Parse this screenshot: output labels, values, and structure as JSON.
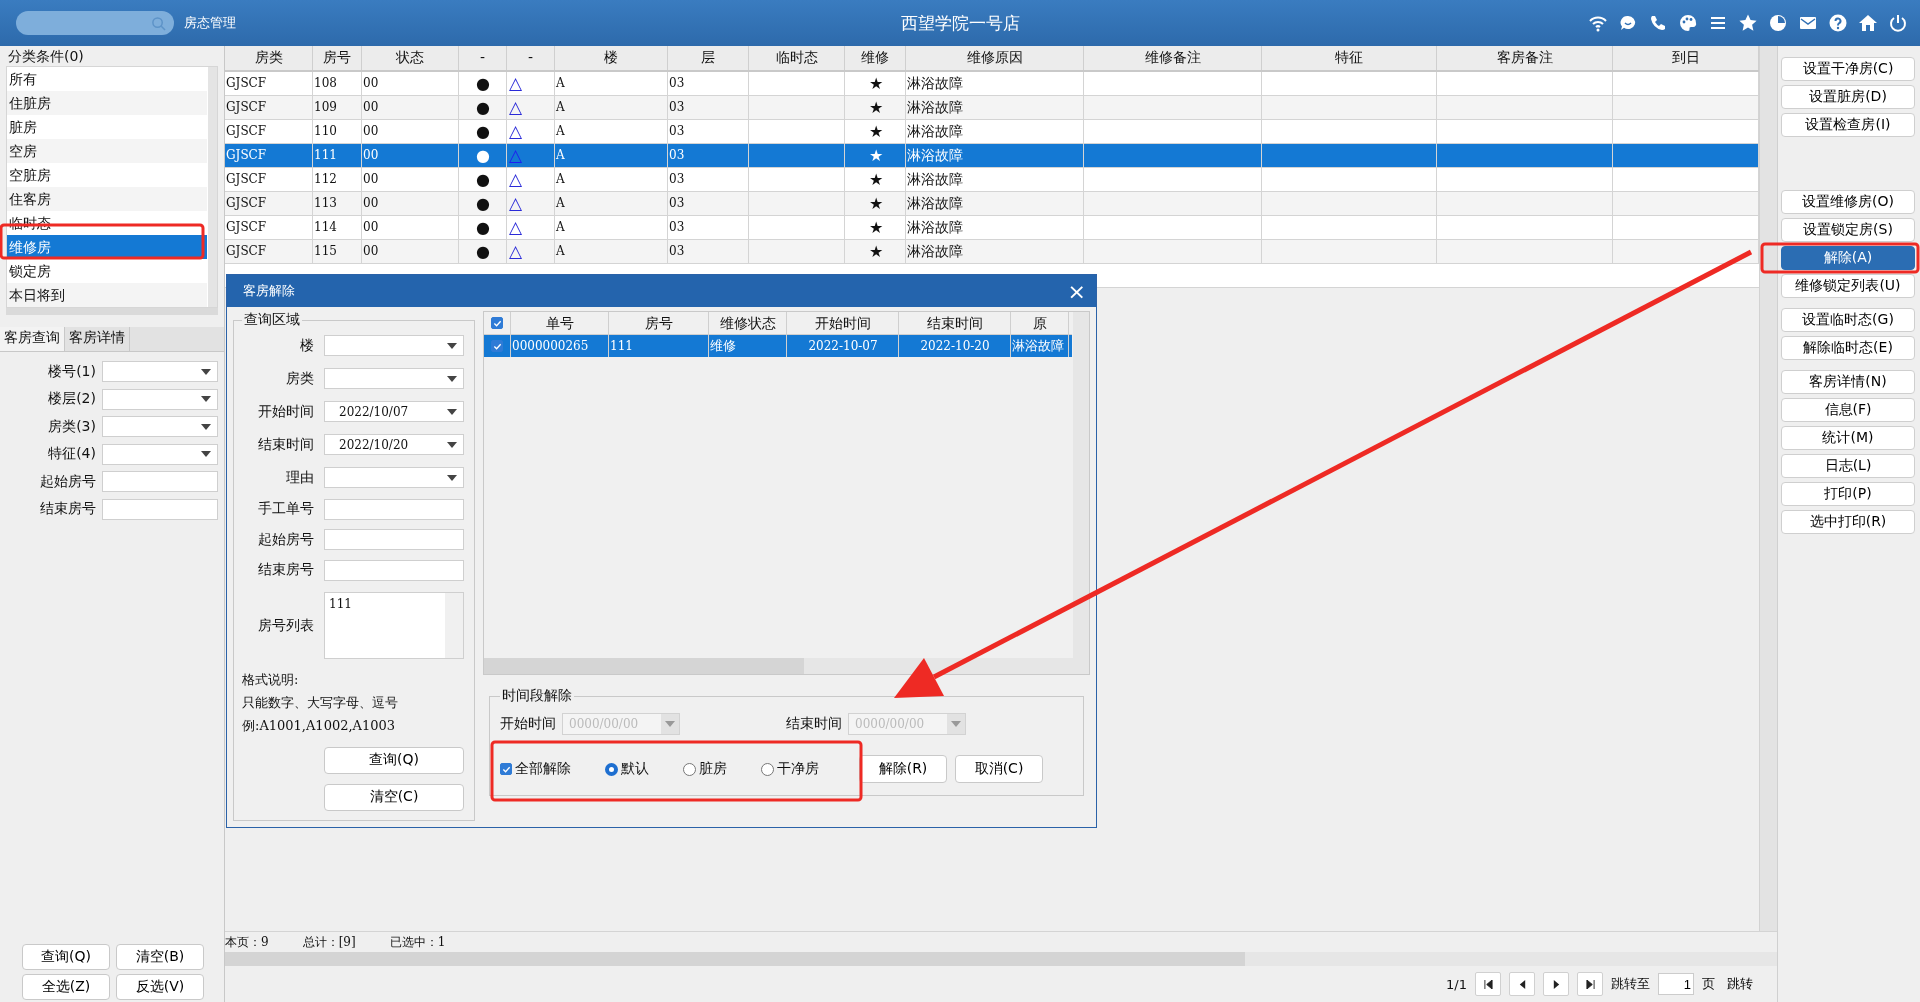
{
  "header": {
    "module": "房态管理",
    "title": "西望学院一号店"
  },
  "categories": {
    "title": "分类条件(0)",
    "items": [
      {
        "label": "所有",
        "selected": false
      },
      {
        "label": "住脏房",
        "selected": false
      },
      {
        "label": "脏房",
        "selected": false
      },
      {
        "label": "空房",
        "selected": false
      },
      {
        "label": "空脏房",
        "selected": false
      },
      {
        "label": "住客房",
        "selected": false
      },
      {
        "label": "临时态",
        "selected": false
      },
      {
        "label": "维修房",
        "selected": true
      },
      {
        "label": "锁定房",
        "selected": false
      },
      {
        "label": "本日将到",
        "selected": false
      }
    ]
  },
  "query_tabs": [
    {
      "label": "客房查询",
      "selected": true
    },
    {
      "label": "客房详情",
      "selected": false
    }
  ],
  "query_fields": [
    {
      "label": "楼号(1)",
      "kind": "select"
    },
    {
      "label": "楼层(2)",
      "kind": "select"
    },
    {
      "label": "房类(3)",
      "kind": "select"
    },
    {
      "label": "特征(4)",
      "kind": "select"
    },
    {
      "label": "起始房号",
      "kind": "text"
    },
    {
      "label": "结束房号",
      "kind": "text"
    }
  ],
  "left_buttons": [
    "查询(Q)",
    "清空(B)",
    "全选(Z)",
    "反选(V)"
  ],
  "table": {
    "columns": [
      "房类",
      "房号",
      "状态",
      "-",
      "-",
      "楼",
      "层",
      "临时态",
      "维修",
      "维修原因",
      "维修备注",
      "特征",
      "客房备注",
      "到日"
    ],
    "rows": [
      {
        "room_type": "GJSCF",
        "room_no": "108",
        "status": "00",
        "dot": "●",
        "triangle": "△",
        "building": "A",
        "floor": "03",
        "repair": "★",
        "reason": "淋浴故障",
        "selected": false
      },
      {
        "room_type": "GJSCF",
        "room_no": "109",
        "status": "00",
        "dot": "●",
        "triangle": "△",
        "building": "A",
        "floor": "03",
        "repair": "★",
        "reason": "淋浴故障",
        "selected": false
      },
      {
        "room_type": "GJSCF",
        "room_no": "110",
        "status": "00",
        "dot": "●",
        "triangle": "△",
        "building": "A",
        "floor": "03",
        "repair": "★",
        "reason": "淋浴故障",
        "selected": false
      },
      {
        "room_type": "GJSCF",
        "room_no": "111",
        "status": "00",
        "dot": "●",
        "triangle": "△",
        "building": "A",
        "floor": "03",
        "repair": "★",
        "reason": "淋浴故障",
        "selected": true
      },
      {
        "room_type": "GJSCF",
        "room_no": "112",
        "status": "00",
        "dot": "●",
        "triangle": "△",
        "building": "A",
        "floor": "03",
        "repair": "★",
        "reason": "淋浴故障",
        "selected": false
      },
      {
        "room_type": "GJSCF",
        "room_no": "113",
        "status": "00",
        "dot": "●",
        "triangle": "△",
        "building": "A",
        "floor": "03",
        "repair": "★",
        "reason": "淋浴故障",
        "selected": false
      },
      {
        "room_type": "GJSCF",
        "room_no": "114",
        "status": "00",
        "dot": "●",
        "triangle": "△",
        "building": "A",
        "floor": "03",
        "repair": "★",
        "reason": "淋浴故障",
        "selected": false
      },
      {
        "room_type": "GJSCF",
        "room_no": "115",
        "status": "00",
        "dot": "●",
        "triangle": "△",
        "building": "A",
        "floor": "03",
        "repair": "★",
        "reason": "淋浴故障",
        "selected": false
      }
    ]
  },
  "status_bar": {
    "page_count": "本页：9",
    "total": "总计：[9]",
    "selected_count": "已选中：1"
  },
  "pager": {
    "pages": "1/1",
    "goto_label": "跳转至",
    "page_value": "1",
    "page_unit": "页",
    "goto_button": "跳转"
  },
  "action_groups": [
    [
      {
        "label": "设置干净房(C)",
        "selected": false
      },
      {
        "label": "设置脏房(D)",
        "selected": false
      },
      {
        "label": "设置检查房(I)",
        "selected": false
      }
    ],
    [
      {
        "label": "设置维修房(O)",
        "selected": false
      },
      {
        "label": "设置锁定房(S)",
        "selected": false
      },
      {
        "label": "解除(A)",
        "selected": true
      },
      {
        "label": "维修锁定列表(U)",
        "selected": false
      }
    ],
    [
      {
        "label": "设置临时态(G)",
        "selected": false
      },
      {
        "label": "解除临时态(E)",
        "selected": false
      }
    ],
    [
      {
        "label": "客房详情(N)",
        "selected": false
      },
      {
        "label": "信息(F)",
        "selected": false
      },
      {
        "label": "统计(M)",
        "selected": false
      },
      {
        "label": "日志(L)",
        "selected": false
      },
      {
        "label": "打印(P)",
        "selected": false
      },
      {
        "label": "选中打印(R)",
        "selected": false
      }
    ]
  ],
  "dialog": {
    "title": "客房解除",
    "close": "×",
    "query_area": {
      "title": "查询区域",
      "fields": [
        {
          "label": "楼",
          "kind": "select"
        },
        {
          "label": "房类",
          "kind": "select"
        },
        {
          "label": "开始时间",
          "kind": "select",
          "value": "2022/10/07"
        },
        {
          "label": "结束时间",
          "kind": "select",
          "value": "2022/10/20"
        },
        {
          "label": "理由",
          "kind": "select"
        },
        {
          "label": "手工单号",
          "kind": "text"
        },
        {
          "label": "起始房号",
          "kind": "text"
        },
        {
          "label": "结束房号",
          "kind": "text"
        },
        {
          "label": "房号列表",
          "kind": "textarea",
          "value": "111"
        }
      ],
      "notes": [
        "格式说明:",
        "只能数字、大写字母、逗号",
        "例:A1001,A1002,A1003"
      ],
      "buttons": [
        "查询(Q)",
        "清空(C)"
      ]
    },
    "grid": {
      "all_checked": true,
      "columns": [
        "单号",
        "房号",
        "维修状态",
        "开始时间",
        "结束时间",
        "原"
      ],
      "rows": [
        {
          "checked": true,
          "selected": true,
          "cells": [
            "0000000265",
            "111",
            "维修",
            "2022-10-07",
            "2022-10-20",
            "淋浴故障"
          ]
        }
      ]
    },
    "period": {
      "title": "时间段解除",
      "start_label": "开始时间",
      "start_value": "0000/00/00",
      "end_label": "结束时间",
      "end_value": "0000/00/00",
      "disabled": true,
      "release_all": {
        "label": "全部解除",
        "checked": true
      },
      "options": [
        {
          "label": "默认",
          "selected": true
        },
        {
          "label": "脏房",
          "selected": false
        },
        {
          "label": "干净房",
          "selected": false
        }
      ],
      "buttons": [
        "解除(R)",
        "取消(C)"
      ]
    }
  }
}
